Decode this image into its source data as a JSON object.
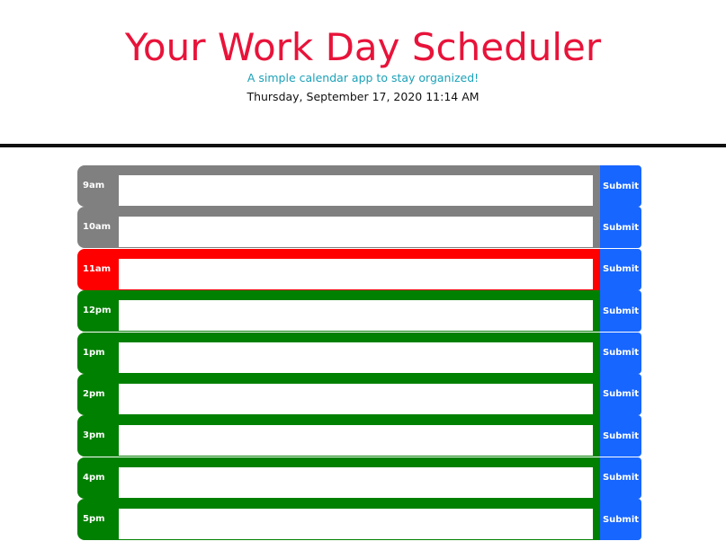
{
  "header": {
    "title": "Your Work Day Scheduler",
    "subtitle": "A simple calendar app to stay organized!",
    "current_datetime": "Thursday, September 17, 2020 11:14 AM"
  },
  "colors": {
    "title": "#e8133a",
    "subtitle": "#1ba1b8",
    "past": "#808080",
    "present": "#ff0000",
    "future": "#008000",
    "submit": "#1766ff"
  },
  "schedule": {
    "submit_label": "Submit",
    "rows": [
      {
        "hour": "9am",
        "status": "past",
        "entry": ""
      },
      {
        "hour": "10am",
        "status": "past",
        "entry": ""
      },
      {
        "hour": "11am",
        "status": "present",
        "entry": ""
      },
      {
        "hour": "12pm",
        "status": "future",
        "entry": ""
      },
      {
        "hour": "1pm",
        "status": "future",
        "entry": ""
      },
      {
        "hour": "2pm",
        "status": "future",
        "entry": ""
      },
      {
        "hour": "3pm",
        "status": "future",
        "entry": ""
      },
      {
        "hour": "4pm",
        "status": "future",
        "entry": ""
      },
      {
        "hour": "5pm",
        "status": "future",
        "entry": ""
      }
    ]
  }
}
